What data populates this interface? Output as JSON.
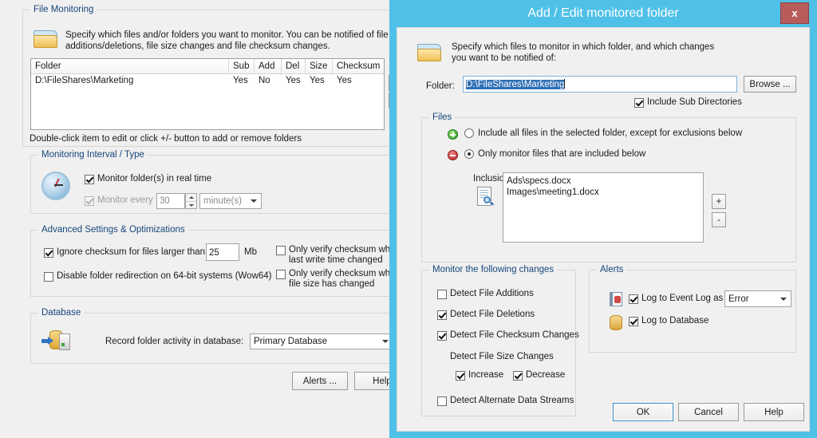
{
  "background_window": {
    "file_monitoring": {
      "group_title": "File Monitoring",
      "description_line1": "Specify which files and/or folders you want to monitor. You can be notified of file",
      "description_line2": "additions/deletions, file size changes and file checksum changes.",
      "folder_icon": "folder-icon",
      "list": {
        "columns": [
          "Folder",
          "Sub",
          "Add",
          "Del",
          "Size",
          "Checksum"
        ],
        "rows": [
          [
            "D:\\FileShares\\Marketing",
            "Yes",
            "No",
            "Yes",
            "Yes",
            "Yes"
          ]
        ]
      },
      "add_button": "+",
      "remove_button": "-",
      "hint": "Double-click item to edit or click +/- button to add or remove folders"
    },
    "monitoring_interval": {
      "group_title": "Monitoring Interval / Type",
      "clock_icon": "clock-icon",
      "realtime_label": "Monitor folder(s) in real time",
      "realtime_checked": true,
      "every_label": "Monitor every",
      "every_checked": true,
      "every_enabled": false,
      "interval_value": "30",
      "unit_value": "minute(s)"
    },
    "advanced": {
      "group_title": "Advanced Settings & Optimizations",
      "ignore_checksum_label": "Ignore checksum for files larger than",
      "ignore_checksum_checked": true,
      "size_value": "25",
      "size_unit": "Mb",
      "wow64_label": "Disable folder redirection on 64-bit systems (Wow64)",
      "wow64_checked": false,
      "verify_write_line1": "Only verify checksum when",
      "verify_write_line2": "last write time changed",
      "verify_write_checked": false,
      "verify_size_line1": "Only verify checksum when",
      "verify_size_line2": "file size has changed",
      "verify_size_checked": false
    },
    "database": {
      "group_title": "Database",
      "db_icon": "database-import-icon",
      "record_label": "Record folder activity in database:",
      "database_value": "Primary Database"
    },
    "footer": {
      "alerts_button": "Alerts ...",
      "help_button": "Help"
    }
  },
  "dialog": {
    "title": "Add / Edit monitored folder",
    "close_label": "x",
    "titlebar_color": "#4fc0e8",
    "close_color": "#b75b5b",
    "header": {
      "folder_icon": "folder-icon",
      "line1": "Specify which files to monitor in which folder, and which changes",
      "line2": "you want to be notified of:"
    },
    "folder_row": {
      "label": "Folder:",
      "value": "D:\\FileShares\\Marketing",
      "selected": true,
      "browse_button": "Browse ...",
      "include_sub_label": "Include Sub Directories",
      "include_sub_checked": true
    },
    "files": {
      "group_title": "Files",
      "option_include_all": {
        "icon": "green-plus-circle-icon",
        "label": "Include all files in the selected folder, except for exclusions below",
        "selected": false
      },
      "option_only_included": {
        "icon": "red-minus-circle-icon",
        "label": "Only monitor files that are included below",
        "selected": true
      },
      "inclusions_label": "Inclusions:",
      "inclusions_icon": "document-search-icon",
      "inclusions_items": [
        "Ads\\specs.docx",
        "Images\\meeting1.docx"
      ],
      "add_button": "+",
      "remove_button": "-"
    },
    "monitor_changes": {
      "group_title": "Monitor the following changes",
      "items": [
        {
          "label": "Detect File Additions",
          "checked": false
        },
        {
          "label": "Detect File Deletions",
          "checked": true
        },
        {
          "label": "Detect File Checksum Changes",
          "checked": true
        }
      ],
      "size_changes_label": "Detect File Size Changes",
      "increase": {
        "label": "Increase",
        "checked": true
      },
      "decrease": {
        "label": "Decrease",
        "checked": true
      },
      "alternate_streams": {
        "label": "Detect Alternate Data Streams",
        "checked": false
      }
    },
    "alerts": {
      "group_title": "Alerts",
      "event_log": {
        "icon": "event-log-icon",
        "label": "Log to Event Log as",
        "checked": true,
        "level_value": "Error"
      },
      "database": {
        "icon": "database-icon",
        "label": "Log to Database",
        "checked": true
      }
    },
    "buttons": {
      "ok": "OK",
      "cancel": "Cancel",
      "help": "Help"
    }
  }
}
